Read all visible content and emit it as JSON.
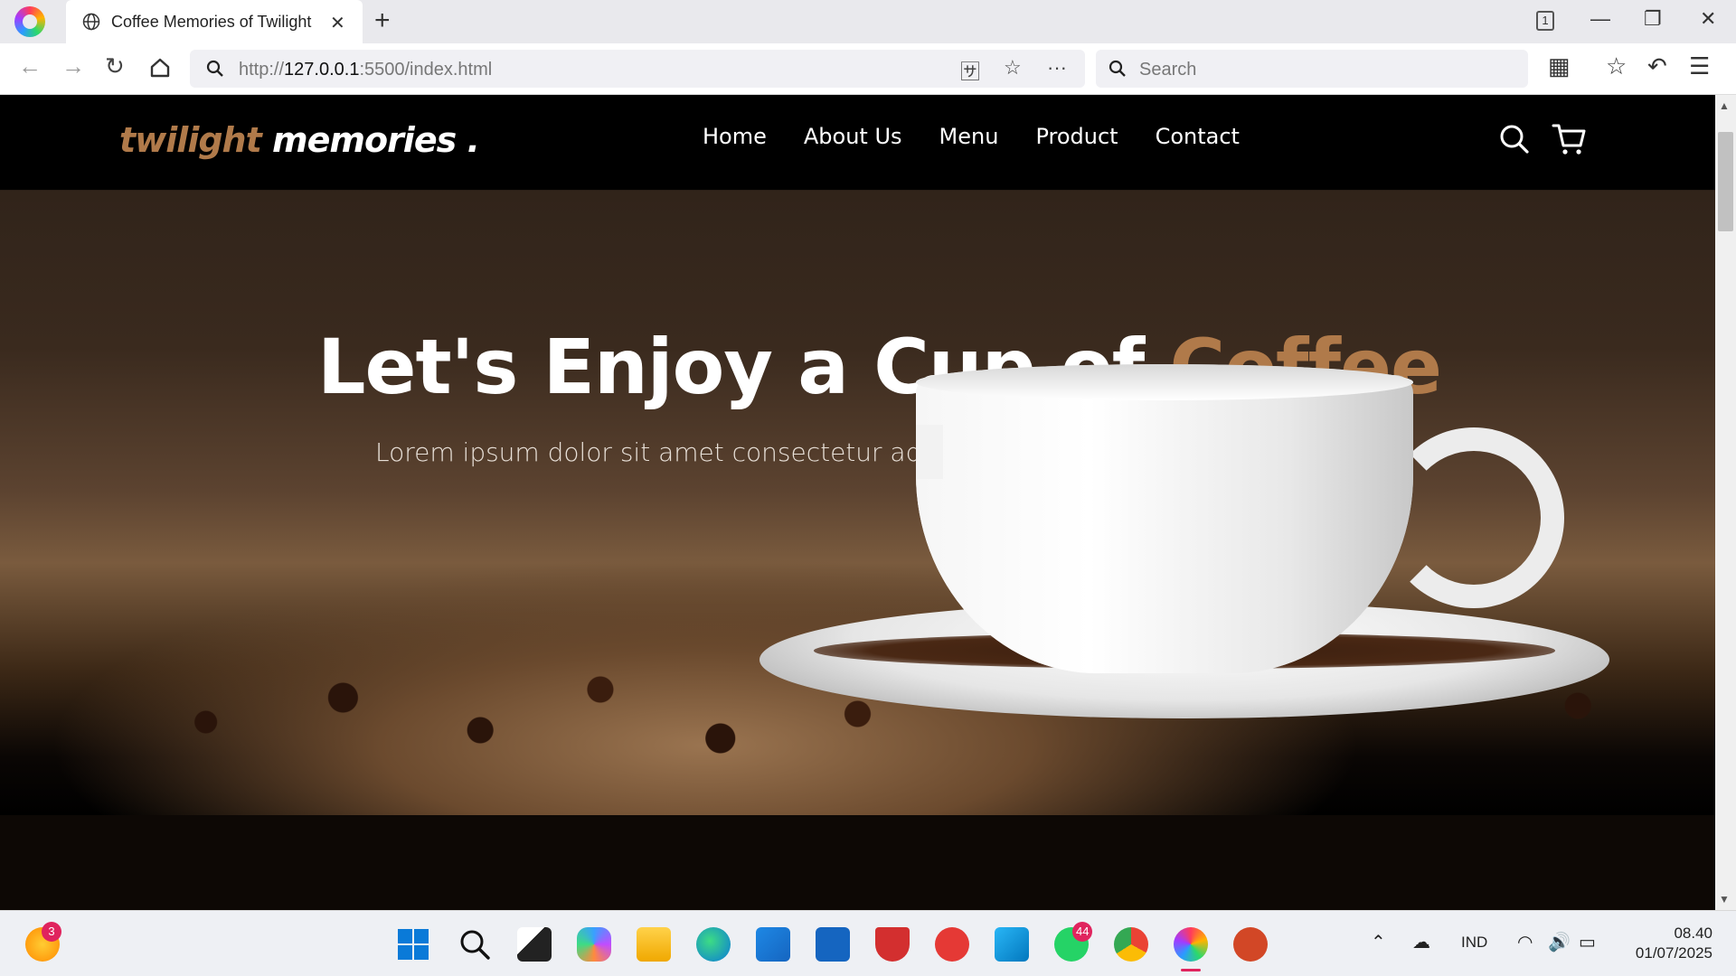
{
  "browser": {
    "tab_title": "Coffee Memories of Twilight",
    "url_prefix": "http://",
    "url_host": "127.0.0.1",
    "url_rest": ":5500/index.html",
    "search_placeholder": "Search",
    "tab_count": "1"
  },
  "site": {
    "logo_accent": "twilight",
    "logo_main": "memories .",
    "nav": [
      "Home",
      "About Us",
      "Menu",
      "Product",
      "Contact"
    ],
    "hero_title_main": "Let's Enjoy a Cup of",
    "hero_title_accent": "Coffee",
    "hero_subtitle": "Lorem ipsum dolor sit amet consectetur ad",
    "accent_color": "#b07a4a"
  },
  "taskbar": {
    "weather_badge": "3",
    "whatsapp_badge": "44",
    "language": "IND",
    "time": "08.40",
    "date": "01/07/2025"
  }
}
